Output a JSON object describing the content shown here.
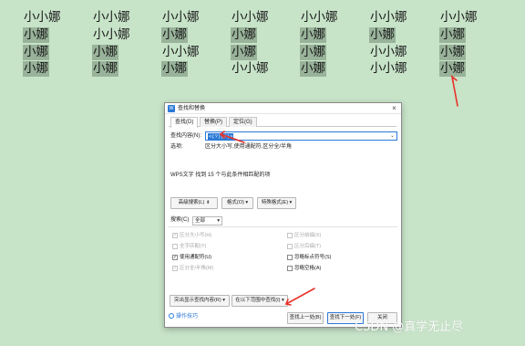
{
  "document": {
    "rows": [
      [
        "小小娜",
        "小小娜",
        "小小娜",
        "小小娜",
        "小小娜",
        "小小娜",
        "小小娜"
      ],
      [
        "小娜",
        "小小娜",
        "小娜",
        "小娜",
        "小娜",
        "小娜",
        "小娜"
      ],
      [
        "小娜",
        "小娜",
        "小小娜",
        "小娜",
        "小娜",
        "小小娜",
        "小娜"
      ],
      [
        "小娜",
        "小娜",
        "小娜",
        "小小娜",
        "小娜",
        "小小娜",
        "小娜"
      ]
    ],
    "highlight_color": "#98b39a"
  },
  "dialog": {
    "title": "查找和替换",
    "tabs": [
      "查找(D)",
      "替换(P)",
      "定位(G)"
    ],
    "find_label": "查找内容(N):",
    "find_value": "<(?)(?)>",
    "options_label": "选项:",
    "options_value": "区分大小写,使用通配符,区分全/半角",
    "result_text": "WPS文字 找到 15 个与此条件相匹配的项",
    "buttons": {
      "advanced": "高级搜索(L) ⇟",
      "format": "格式(O) ▾",
      "special": "特殊格式(E) ▾",
      "highlight": "突出显示查找内容(R) ▾",
      "find_in": "在以下范围中查找(I) ▾",
      "find_prev": "查找上一处(B)",
      "find_next": "查找下一处(F)",
      "close": "关闭"
    },
    "search_label": "搜索(C)",
    "search_value": "全部",
    "checkboxes_left": [
      {
        "label": "区分大小写(H)",
        "checked": true,
        "disabled": true
      },
      {
        "label": "全字匹配(Y)",
        "checked": false,
        "disabled": true
      },
      {
        "label": "使用通配符(U)",
        "checked": true,
        "disabled": false
      },
      {
        "label": "区分全/半角(M)",
        "checked": true,
        "disabled": true
      }
    ],
    "checkboxes_right": [
      {
        "label": "区分前缀(X)",
        "checked": false,
        "disabled": true
      },
      {
        "label": "区分后缀(T)",
        "checked": false,
        "disabled": true
      },
      {
        "label": "忽略标点符号(S)",
        "checked": false,
        "disabled": false
      },
      {
        "label": "忽略空格(A)",
        "checked": false,
        "disabled": false
      }
    ],
    "tips_link": "操作技巧"
  },
  "annotation_color": "#e8322a",
  "watermark": "CSDN @真学无止尽"
}
